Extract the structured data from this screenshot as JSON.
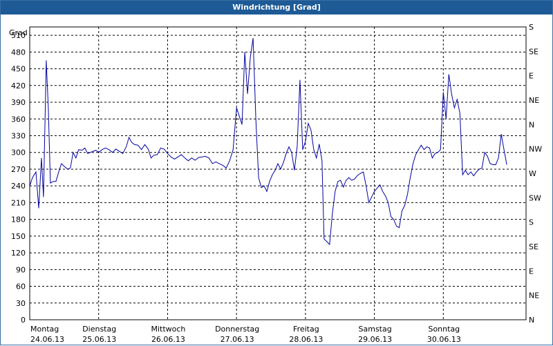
{
  "window": {
    "title": "Windrichtung [Grad]"
  },
  "chart_data": {
    "type": "line",
    "title": "Windrichtung [Grad]",
    "ylabel": "Grad",
    "ylim": [
      0,
      525
    ],
    "y_ticks": [
      0,
      30,
      60,
      90,
      120,
      150,
      180,
      210,
      240,
      270,
      300,
      330,
      360,
      390,
      420,
      450,
      480,
      510
    ],
    "right_axis_ticks": [
      {
        "value": 0,
        "label": "N"
      },
      {
        "value": 45,
        "label": "NE"
      },
      {
        "value": 90,
        "label": "E"
      },
      {
        "value": 135,
        "label": "SE"
      },
      {
        "value": 180,
        "label": "S"
      },
      {
        "value": 225,
        "label": "SW"
      },
      {
        "value": 270,
        "label": "W"
      },
      {
        "value": 315,
        "label": "NW"
      },
      {
        "value": 360,
        "label": "N"
      },
      {
        "value": 405,
        "label": "NE"
      },
      {
        "value": 450,
        "label": "E"
      },
      {
        "value": 495,
        "label": "SE"
      },
      {
        "value": 540,
        "label": "S"
      }
    ],
    "xlim": [
      0,
      7.2
    ],
    "x_ticks": [
      {
        "x": 0,
        "day": "Montag",
        "date": "24.06.13"
      },
      {
        "x": 1,
        "day": "Dienstag",
        "date": "25.06.13"
      },
      {
        "x": 2,
        "day": "Mittwoch",
        "date": "26.06.13"
      },
      {
        "x": 3,
        "day": "Donnerstag",
        "date": "27.06.13"
      },
      {
        "x": 4,
        "day": "Freitag",
        "date": "28.06.13"
      },
      {
        "x": 5,
        "day": "Samstag",
        "date": "29.06.13"
      },
      {
        "x": 6,
        "day": "Sonntag",
        "date": "30.06.13"
      }
    ],
    "grid": true,
    "line_color": "#0000a0",
    "series": [
      {
        "points": [
          [
            0.0,
            240
          ],
          [
            0.04,
            255
          ],
          [
            0.09,
            265
          ],
          [
            0.13,
            200
          ],
          [
            0.17,
            290
          ],
          [
            0.2,
            220
          ],
          [
            0.24,
            465
          ],
          [
            0.27,
            380
          ],
          [
            0.3,
            245
          ],
          [
            0.34,
            248
          ],
          [
            0.38,
            248
          ],
          [
            0.42,
            265
          ],
          [
            0.46,
            280
          ],
          [
            0.5,
            275
          ],
          [
            0.55,
            270
          ],
          [
            0.59,
            272
          ],
          [
            0.63,
            300
          ],
          [
            0.67,
            290
          ],
          [
            0.71,
            305
          ],
          [
            0.76,
            304
          ],
          [
            0.8,
            308
          ],
          [
            0.84,
            298
          ],
          [
            0.88,
            300
          ],
          [
            0.92,
            302
          ],
          [
            0.96,
            304
          ],
          [
            1.0,
            300
          ],
          [
            1.05,
            305
          ],
          [
            1.1,
            308
          ],
          [
            1.15,
            305
          ],
          [
            1.2,
            300
          ],
          [
            1.25,
            306
          ],
          [
            1.3,
            302
          ],
          [
            1.35,
            298
          ],
          [
            1.4,
            310
          ],
          [
            1.44,
            327
          ],
          [
            1.48,
            318
          ],
          [
            1.52,
            314
          ],
          [
            1.57,
            313
          ],
          [
            1.62,
            305
          ],
          [
            1.67,
            314
          ],
          [
            1.72,
            306
          ],
          [
            1.76,
            290
          ],
          [
            1.8,
            295
          ],
          [
            1.85,
            296
          ],
          [
            1.9,
            308
          ],
          [
            1.95,
            306
          ],
          [
            2.0,
            298
          ],
          [
            2.05,
            292
          ],
          [
            2.1,
            288
          ],
          [
            2.15,
            292
          ],
          [
            2.2,
            296
          ],
          [
            2.25,
            290
          ],
          [
            2.3,
            285
          ],
          [
            2.35,
            290
          ],
          [
            2.4,
            286
          ],
          [
            2.45,
            291
          ],
          [
            2.5,
            292
          ],
          [
            2.55,
            293
          ],
          [
            2.6,
            290
          ],
          [
            2.65,
            280
          ],
          [
            2.7,
            283
          ],
          [
            2.75,
            280
          ],
          [
            2.8,
            277
          ],
          [
            2.85,
            272
          ],
          [
            2.9,
            285
          ],
          [
            2.95,
            305
          ],
          [
            3.0,
            380
          ],
          [
            3.04,
            365
          ],
          [
            3.08,
            350
          ],
          [
            3.12,
            480
          ],
          [
            3.16,
            405
          ],
          [
            3.2,
            470
          ],
          [
            3.24,
            505
          ],
          [
            3.28,
            360
          ],
          [
            3.32,
            255
          ],
          [
            3.36,
            237
          ],
          [
            3.4,
            240
          ],
          [
            3.44,
            230
          ],
          [
            3.48,
            248
          ],
          [
            3.52,
            260
          ],
          [
            3.56,
            268
          ],
          [
            3.6,
            280
          ],
          [
            3.64,
            270
          ],
          [
            3.68,
            282
          ],
          [
            3.72,
            298
          ],
          [
            3.76,
            310
          ],
          [
            3.8,
            300
          ],
          [
            3.84,
            268
          ],
          [
            3.88,
            310
          ],
          [
            3.92,
            430
          ],
          [
            3.96,
            305
          ],
          [
            4.0,
            320
          ],
          [
            4.04,
            352
          ],
          [
            4.08,
            340
          ],
          [
            4.12,
            305
          ],
          [
            4.16,
            290
          ],
          [
            4.2,
            315
          ],
          [
            4.24,
            285
          ],
          [
            4.27,
            145
          ],
          [
            4.31,
            140
          ],
          [
            4.35,
            135
          ],
          [
            4.39,
            190
          ],
          [
            4.43,
            230
          ],
          [
            4.47,
            248
          ],
          [
            4.51,
            250
          ],
          [
            4.55,
            238
          ],
          [
            4.59,
            250
          ],
          [
            4.63,
            255
          ],
          [
            4.67,
            250
          ],
          [
            4.71,
            252
          ],
          [
            4.75,
            258
          ],
          [
            4.79,
            262
          ],
          [
            4.84,
            265
          ],
          [
            4.88,
            240
          ],
          [
            4.92,
            210
          ],
          [
            4.96,
            220
          ],
          [
            5.0,
            230
          ],
          [
            5.04,
            236
          ],
          [
            5.08,
            242
          ],
          [
            5.12,
            230
          ],
          [
            5.16,
            222
          ],
          [
            5.2,
            210
          ],
          [
            5.24,
            185
          ],
          [
            5.28,
            180
          ],
          [
            5.32,
            168
          ],
          [
            5.36,
            165
          ],
          [
            5.4,
            195
          ],
          [
            5.44,
            205
          ],
          [
            5.48,
            225
          ],
          [
            5.52,
            255
          ],
          [
            5.56,
            280
          ],
          [
            5.6,
            296
          ],
          [
            5.64,
            305
          ],
          [
            5.68,
            313
          ],
          [
            5.72,
            305
          ],
          [
            5.76,
            310
          ],
          [
            5.8,
            308
          ],
          [
            5.84,
            290
          ],
          [
            5.88,
            298
          ],
          [
            5.92,
            300
          ],
          [
            5.96,
            305
          ],
          [
            6.0,
            408
          ],
          [
            6.04,
            360
          ],
          [
            6.08,
            440
          ],
          [
            6.12,
            405
          ],
          [
            6.16,
            380
          ],
          [
            6.2,
            395
          ],
          [
            6.24,
            370
          ],
          [
            6.28,
            260
          ],
          [
            6.32,
            268
          ],
          [
            6.36,
            260
          ],
          [
            6.4,
            265
          ],
          [
            6.44,
            258
          ],
          [
            6.48,
            265
          ],
          [
            6.52,
            270
          ],
          [
            6.56,
            272
          ],
          [
            6.6,
            300
          ],
          [
            6.64,
            293
          ],
          [
            6.68,
            280
          ],
          [
            6.72,
            278
          ],
          [
            6.76,
            278
          ],
          [
            6.8,
            290
          ],
          [
            6.84,
            333
          ],
          [
            6.88,
            305
          ],
          [
            6.92,
            278
          ]
        ]
      }
    ]
  }
}
